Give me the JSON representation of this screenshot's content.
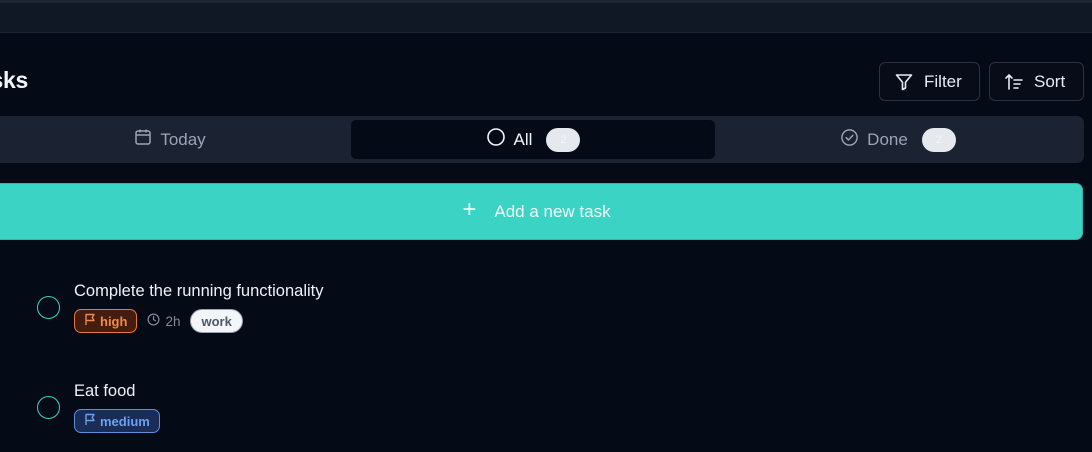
{
  "page": {
    "title": "asks"
  },
  "header": {
    "filter_label": "Filter",
    "sort_label": "Sort"
  },
  "tabs": [
    {
      "label": "Today",
      "icon": "calendar-icon",
      "count": null
    },
    {
      "label": "All",
      "icon": "circle-icon",
      "count": "2",
      "selected": true
    },
    {
      "label": "Done",
      "icon": "check-circle-icon",
      "count": "2"
    }
  ],
  "add_task": {
    "label": "Add a new task",
    "icon": "plus-icon"
  },
  "tasks": [
    {
      "title": "Complete the running functionality",
      "priority": "high",
      "duration": "2h",
      "tag": "work"
    },
    {
      "title": "Eat food",
      "priority": "medium"
    }
  ],
  "colors": {
    "background": "#050a17",
    "accent": "#3ad3c4",
    "high_priority": "#f08a4c",
    "medium_priority": "#6aa1ee"
  }
}
